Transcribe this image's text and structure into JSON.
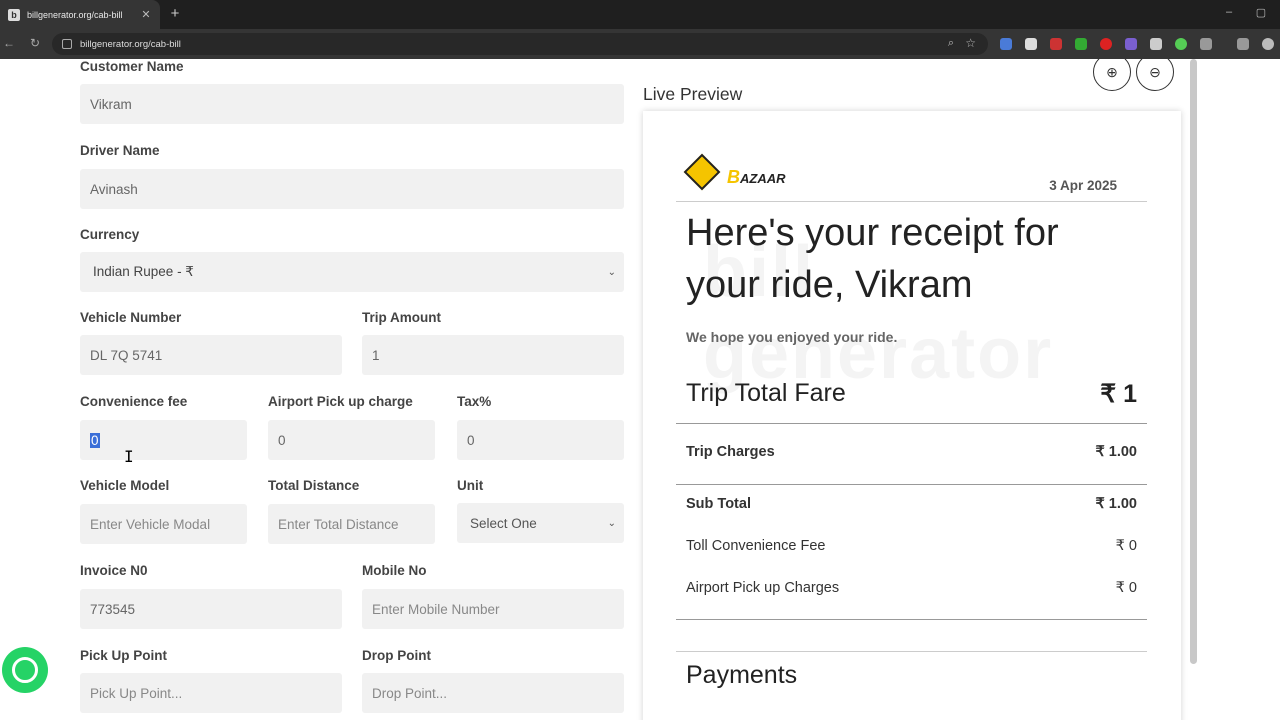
{
  "browser": {
    "tab_title": "billgenerator.org/cab-bill",
    "tab_close": "✕",
    "new_tab": "+",
    "url": "billgenerator.org/cab-bill",
    "window_minimize": "–",
    "window_maximize": "▢"
  },
  "form": {
    "customer_name_label": "Customer Name",
    "customer_name_value": "Vikram",
    "driver_name_label": "Driver Name",
    "driver_name_value": "Avinash",
    "currency_label": "Currency",
    "currency_value": "Indian Rupee - ₹",
    "vehicle_number_label": "Vehicle Number",
    "vehicle_number_value": "DL 7Q 5741",
    "trip_amount_label": "Trip Amount",
    "trip_amount_value": "1",
    "convenience_fee_label": "Convenience fee",
    "convenience_fee_value": "0",
    "airport_label": "Airport Pick up charge",
    "airport_value": "0",
    "tax_label": "Tax%",
    "tax_value": "0",
    "vehicle_model_label": "Vehicle Model",
    "vehicle_model_placeholder": "Enter Vehicle Modal",
    "total_distance_label": "Total Distance",
    "total_distance_placeholder": "Enter Total Distance",
    "unit_label": "Unit",
    "unit_value": "Select One",
    "invoice_label": "Invoice N0",
    "invoice_value": "773545",
    "mobile_label": "Mobile No",
    "mobile_placeholder": "Enter Mobile Number",
    "pickup_label": "Pick Up Point",
    "pickup_placeholder": "Pick Up Point...",
    "drop_label": "Drop Point",
    "drop_placeholder": "Drop Point..."
  },
  "preview": {
    "title": "Live Preview",
    "logo_text": "AZAAR",
    "logo_letter": "B",
    "date": "3 Apr 2025",
    "heading": "Here's your receipt for your ride, Vikram",
    "hope": "We hope you enjoyed your ride.",
    "total_label": "Trip Total Fare",
    "total_value": "₹ 1",
    "trip_charges_label": "Trip Charges",
    "trip_charges_value": "₹ 1.00",
    "sub_total_label": "Sub Total",
    "sub_total_value": "₹ 1.00",
    "toll_label": "Toll Convenience Fee",
    "toll_value": "₹ 0",
    "airport_label": "Airport Pick up Charges",
    "airport_value": "₹ 0",
    "payments_label": "Payments",
    "watermark": "bill generator"
  },
  "icons": {
    "zoom_in": "⊕",
    "zoom_out": "⊖",
    "chevron": "⌄",
    "back": "←",
    "forward": "→",
    "reload": "↻",
    "star": "☆",
    "magnifier": "⌕"
  },
  "colors": {
    "accent_yellow": "#f5c400",
    "whatsapp_green": "#25d366"
  }
}
